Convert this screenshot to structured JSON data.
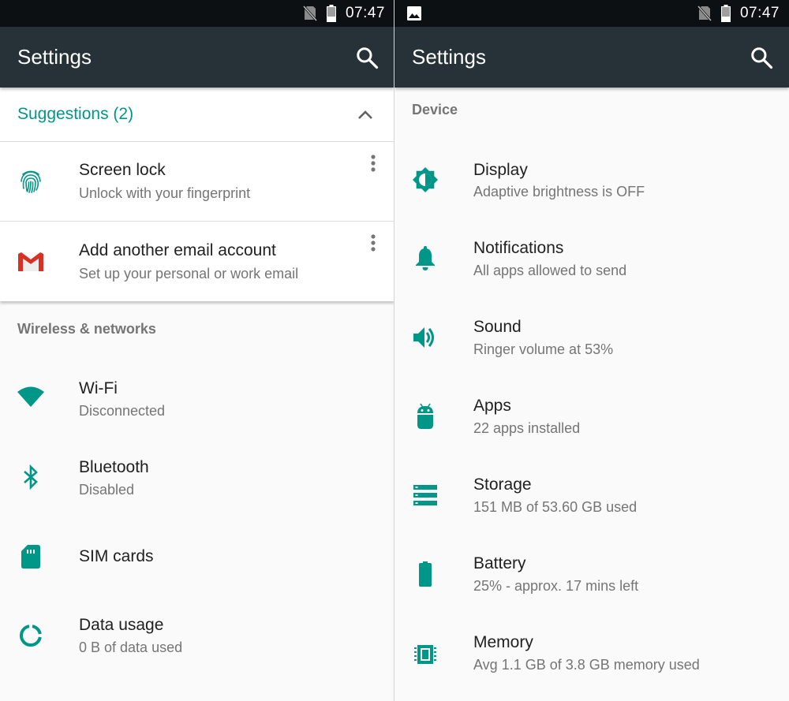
{
  "colors": {
    "accent": "#009688",
    "appbar": "#263238",
    "statusbar": "#0d1012",
    "gmail_red": "#d93025"
  },
  "left": {
    "status": {
      "time": "07:47"
    },
    "appbar": {
      "title": "Settings"
    },
    "suggestions": {
      "title": "Suggestions (2)",
      "items": [
        {
          "title": "Screen lock",
          "subtitle": "Unlock with your fingerprint",
          "icon": "fingerprint-icon"
        },
        {
          "title": "Add another email account",
          "subtitle": "Set up your personal or work email",
          "icon": "gmail-icon"
        }
      ]
    },
    "section": "Wireless & networks",
    "items": [
      {
        "title": "Wi-Fi",
        "subtitle": "Disconnected",
        "icon": "wifi-icon"
      },
      {
        "title": "Bluetooth",
        "subtitle": "Disabled",
        "icon": "bluetooth-icon"
      },
      {
        "title": "SIM cards",
        "icon": "sim-card-icon"
      },
      {
        "title": "Data usage",
        "subtitle": "0 B of data used",
        "icon": "data-usage-icon"
      }
    ]
  },
  "right": {
    "status": {
      "time": "07:47"
    },
    "appbar": {
      "title": "Settings"
    },
    "section": "Device",
    "items": [
      {
        "title": "Display",
        "subtitle": "Adaptive brightness is OFF",
        "icon": "brightness-icon"
      },
      {
        "title": "Notifications",
        "subtitle": "All apps allowed to send",
        "icon": "bell-icon"
      },
      {
        "title": "Sound",
        "subtitle": "Ringer volume at 53%",
        "icon": "volume-icon"
      },
      {
        "title": "Apps",
        "subtitle": "22 apps installed",
        "icon": "android-icon"
      },
      {
        "title": "Storage",
        "subtitle": "151 MB of 53.60 GB used",
        "icon": "storage-icon"
      },
      {
        "title": "Battery",
        "subtitle": "25% - approx. 17 mins left",
        "icon": "battery-icon"
      },
      {
        "title": "Memory",
        "subtitle": "Avg 1.1 GB of 3.8 GB memory used",
        "icon": "memory-icon"
      }
    ]
  }
}
